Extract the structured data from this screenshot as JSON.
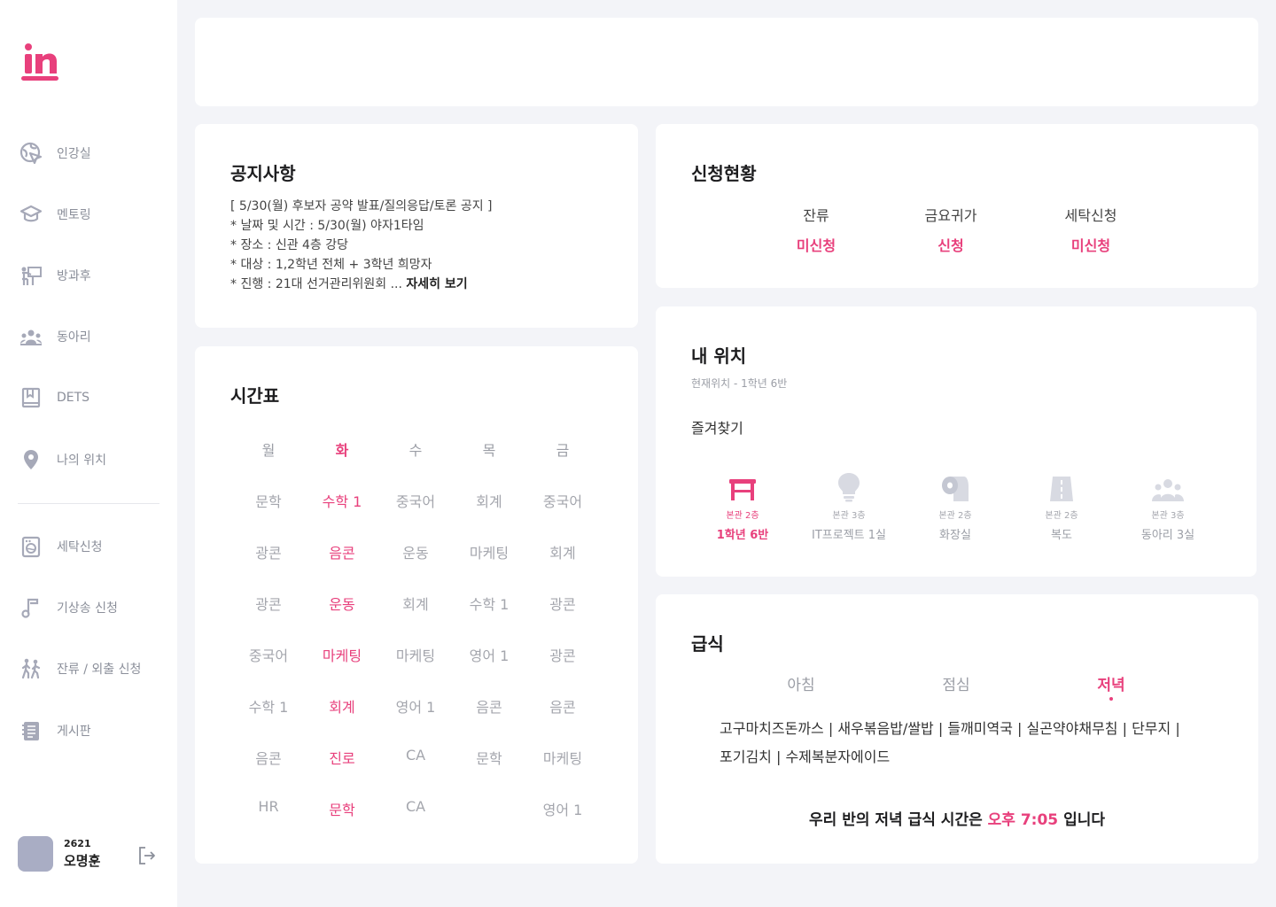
{
  "sidebar": {
    "nav": [
      {
        "label": "인강실",
        "icon": "globe-cursor-icon"
      },
      {
        "label": "멘토링",
        "icon": "graduation-cap-icon"
      },
      {
        "label": "방과후",
        "icon": "classroom-icon"
      },
      {
        "label": "동아리",
        "icon": "group-icon"
      },
      {
        "label": "DETS",
        "icon": "book-icon"
      },
      {
        "label": "나의 위치",
        "icon": "location-pin-icon"
      },
      {
        "label": "세탁신청",
        "icon": "washing-machine-icon"
      },
      {
        "label": "기상송 신청",
        "icon": "music-note-icon"
      },
      {
        "label": "잔류 / 외출 신청",
        "icon": "walking-people-icon"
      },
      {
        "label": "게시판",
        "icon": "notebook-icon"
      }
    ],
    "user": {
      "id": "2621",
      "name": "오명훈"
    }
  },
  "notice": {
    "title": "공지사항",
    "lines": [
      "[ 5/30(월) 후보자 공약 발표/질의응답/토론 공지 ]",
      "* 날짜 및 시간 : 5/30(월) 야자1타임",
      "* 장소 : 신관 4층 강당",
      "* 대상 : 1,2학년 전체 + 3학년 희망자",
      "* 진행 : 21대 선거관리위원회 ..."
    ],
    "more": "자세히 보기"
  },
  "timetable": {
    "title": "시간표",
    "days": [
      "월",
      "화",
      "수",
      "목",
      "금"
    ],
    "today_index": 1,
    "rows": [
      [
        "문학",
        "수학 1",
        "중국어",
        "회계",
        "중국어"
      ],
      [
        "광콘",
        "음콘",
        "운동",
        "마케팅",
        "회계"
      ],
      [
        "광콘",
        "운동",
        "회계",
        "수학 1",
        "광콘"
      ],
      [
        "중국어",
        "마케팅",
        "마케팅",
        "영어 1",
        "광콘"
      ],
      [
        "수학 1",
        "회계",
        "영어 1",
        "음콘",
        "음콘"
      ],
      [
        "음콘",
        "진로",
        "CA",
        "문학",
        "마케팅"
      ],
      [
        "HR",
        "문학",
        "CA",
        "",
        "영어 1"
      ]
    ]
  },
  "applications": {
    "title": "신청현황",
    "items": [
      {
        "label": "잔류",
        "status": "미신청"
      },
      {
        "label": "금요귀가",
        "status": "신청"
      },
      {
        "label": "세탁신청",
        "status": "미신청"
      }
    ]
  },
  "location": {
    "title": "내 위치",
    "current": "현재위치 - 1학년 6반",
    "favorites_title": "즐겨찾기",
    "favorites": [
      {
        "floor": "본관 2층",
        "room": "1학년 6반",
        "icon": "desk-icon",
        "active": true
      },
      {
        "floor": "본관 3층",
        "room": "IT프로젝트 1실",
        "icon": "lightbulb-icon",
        "active": false
      },
      {
        "floor": "본관 2층",
        "room": "화장실",
        "icon": "toilet-paper-icon",
        "active": false
      },
      {
        "floor": "본관 2층",
        "room": "복도",
        "icon": "hallway-icon",
        "active": false
      },
      {
        "floor": "본관 3층",
        "room": "동아리 3실",
        "icon": "club-group-icon",
        "active": false
      }
    ]
  },
  "meal": {
    "title": "급식",
    "tabs": [
      "아침",
      "점심",
      "저녁"
    ],
    "active_tab": 2,
    "menu_lines": [
      "고구마치즈돈까스 | 새우볶음밥/쌀밥 | 들깨미역국 | 실곤약야채무침 | 단무지 |",
      "포기김치 | 수제복분자에이드"
    ],
    "time_prefix": "우리 반의 저녁 급식 시간은",
    "time_value": "오후 7:05",
    "time_suffix": "입니다"
  },
  "colors": {
    "accent": "#e8407c",
    "icon_gray": "#a6a9b8",
    "background": "#f3f4f8"
  }
}
